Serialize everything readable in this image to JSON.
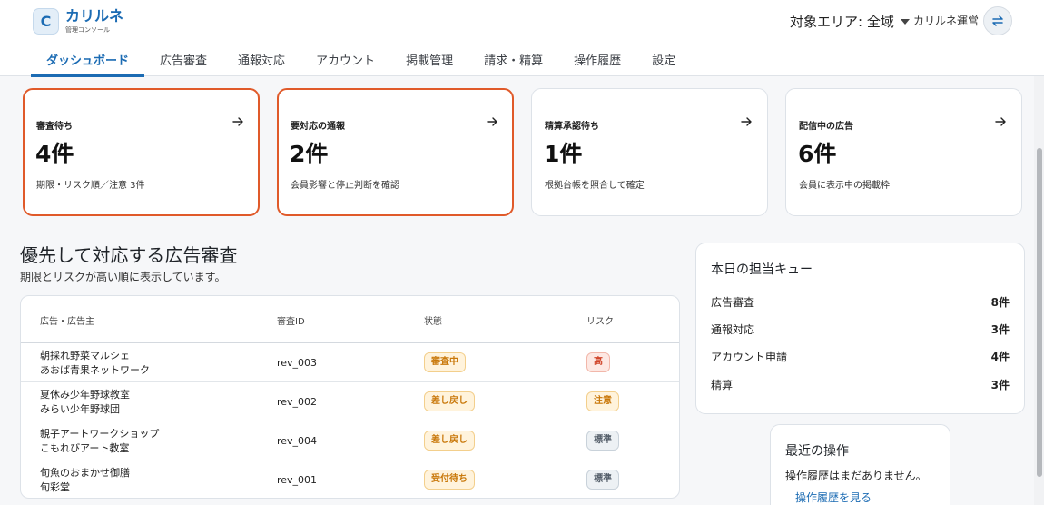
{
  "app": {
    "logo_letter": "C",
    "name": "カリルネ",
    "subtitle": "管理コンソール"
  },
  "header": {
    "area_label": "対象エリア: 全域",
    "operator": "カリルネ運営",
    "switch_icon": "swap-arrows-icon"
  },
  "nav": {
    "tabs": [
      {
        "label": "ダッシュボード",
        "active": true
      },
      {
        "label": "広告審査"
      },
      {
        "label": "通報対応"
      },
      {
        "label": "アカウント"
      },
      {
        "label": "掲載管理"
      },
      {
        "label": "請求・精算"
      },
      {
        "label": "操作履歴"
      },
      {
        "label": "設定"
      }
    ]
  },
  "cards": [
    {
      "title": "審査待ち",
      "value": "4件",
      "desc": "期限・リスク順／注意 3件",
      "highlight": true
    },
    {
      "title": "要対応の通報",
      "value": "2件",
      "desc": "会員影響と停止判断を確認",
      "highlight": true
    },
    {
      "title": "精算承認待ち",
      "value": "1件",
      "desc": "根拠台帳を照合して確定",
      "highlight": false
    },
    {
      "title": "配信中の広告",
      "value": "6件",
      "desc": "会員に表示中の掲載枠",
      "highlight": false
    }
  ],
  "review": {
    "title": "優先して対応する広告審査",
    "subtitle": "期限とリスクが高い順に表示しています。",
    "columns": [
      "広告・広告主",
      "審査ID",
      "状態",
      "リスク"
    ],
    "rows": [
      {
        "ad": "朝採れ野菜マルシェ",
        "advertiser": "あおば青果ネットワーク",
        "id": "rev_003",
        "status": "審査中",
        "status_color": "orange",
        "risk": "高",
        "risk_color": "red"
      },
      {
        "ad": "夏休み少年野球教室",
        "advertiser": "みらい少年野球団",
        "id": "rev_002",
        "status": "差し戻し",
        "status_color": "orange",
        "risk": "注意",
        "risk_color": "orange"
      },
      {
        "ad": "親子アートワークショップ",
        "advertiser": "こもれびアート教室",
        "id": "rev_004",
        "status": "差し戻し",
        "status_color": "orange",
        "risk": "標準",
        "risk_color": "gray"
      },
      {
        "ad": "旬魚のおまかせ御膳",
        "advertiser": "旬彩堂",
        "id": "rev_001",
        "status": "受付待ち",
        "status_color": "orange",
        "risk": "標準",
        "risk_color": "gray"
      }
    ]
  },
  "queue": {
    "title": "本日の担当キュー",
    "items": [
      {
        "label": "広告審査",
        "value": "8件"
      },
      {
        "label": "通報対応",
        "value": "3件"
      },
      {
        "label": "アカウント申請",
        "value": "4件"
      },
      {
        "label": "精算",
        "value": "3件"
      }
    ]
  },
  "recent": {
    "title": "最近の操作",
    "empty": "操作履歴はまだありません。",
    "link": "操作履歴を見る"
  },
  "colors": {
    "accent": "#1b6bb3",
    "alert_border": "#e05a2a"
  }
}
